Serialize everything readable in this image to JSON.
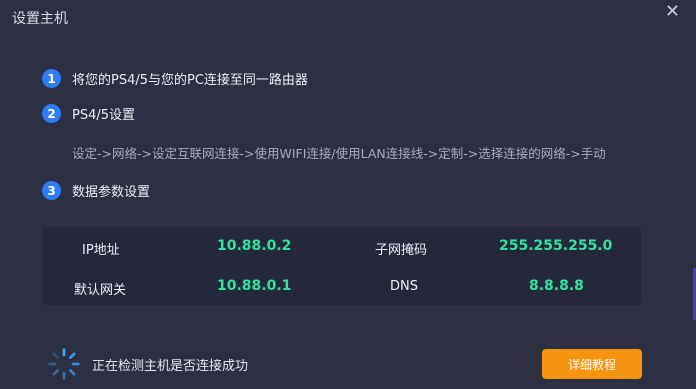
{
  "window": {
    "title": "设置主机",
    "close_icon": "close-icon"
  },
  "steps": [
    {
      "number": "1",
      "label": "将您的PS4/5与您的PC连接至同一路由器"
    },
    {
      "number": "2",
      "label": "PS4/5设置",
      "description": "设定->网络->设定互联网连接->使用WIFI连接/使用LAN连接线->定制->选择连接的网络->手动"
    },
    {
      "number": "3",
      "label": "数据参数设置"
    }
  ],
  "params": {
    "ip_label": "IP地址",
    "ip_value": "10.88.0.2",
    "mask_label": "子网掩码",
    "mask_value": "255.255.255.0",
    "gateway_label": "默认网关",
    "gateway_value": "10.88.0.1",
    "dns_label": "DNS",
    "dns_value": "8.8.8.8"
  },
  "status": {
    "icon": "loading-spinner-icon",
    "text": "正在检测主机是否连接成功"
  },
  "actions": {
    "tutorial_label": "详细教程"
  },
  "colors": {
    "background": "#2d2f42",
    "panel": "#25273a",
    "accent_blue": "#2e7cf6",
    "value_green": "#2ee59d",
    "button_orange": "#f5940f"
  }
}
